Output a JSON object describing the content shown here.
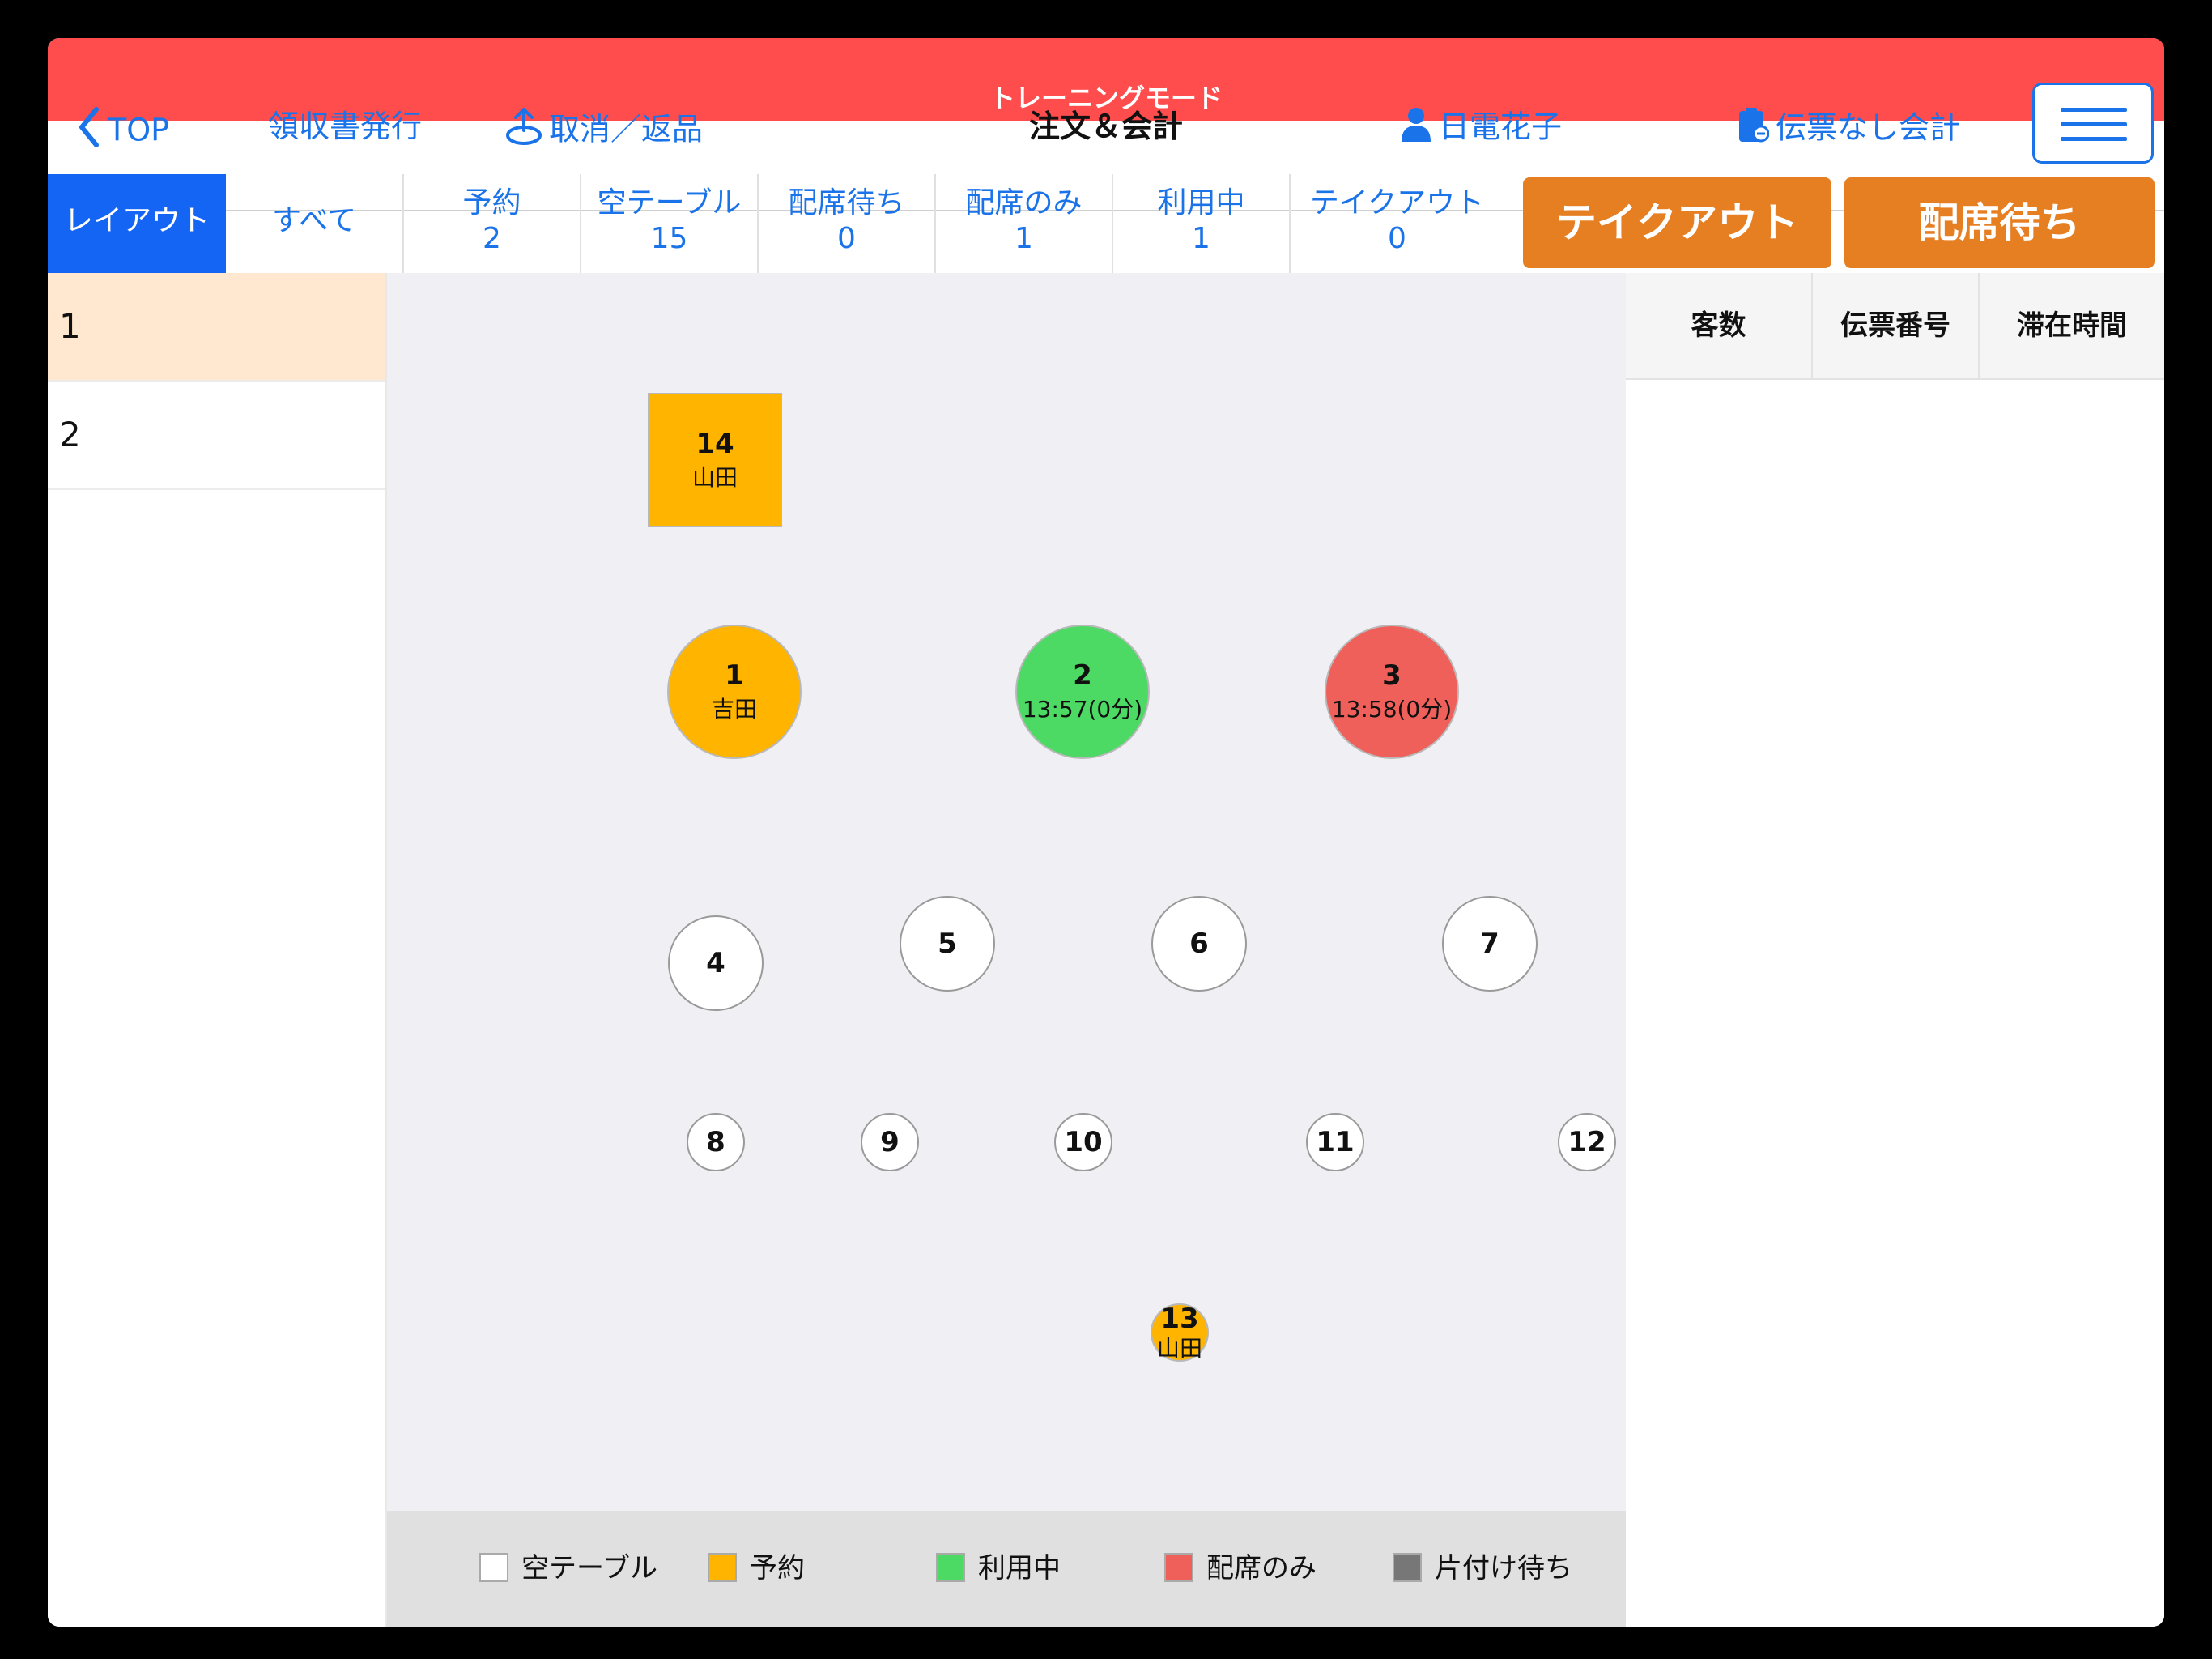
{
  "header": {
    "training_label": "トレーニングモード",
    "back_label": "TOP",
    "receipt_label": "領収書発行",
    "cancel_return_label": "取消／返品",
    "title": "注文＆会計",
    "user_name": "日電花子",
    "no_slip_label": "伝票なし会計",
    "colors": {
      "training_bar": "#ff4c4c",
      "link": "#1a73e8"
    }
  },
  "tabs": [
    {
      "label": "レイアウト",
      "count": null,
      "active": true
    },
    {
      "label": "すべて",
      "count": null
    },
    {
      "label": "予約",
      "count": "2"
    },
    {
      "label": "空テーブル",
      "count": "15"
    },
    {
      "label": "配席待ち",
      "count": "0"
    },
    {
      "label": "配席のみ",
      "count": "1"
    },
    {
      "label": "利用中",
      "count": "1"
    },
    {
      "label": "テイクアウト",
      "count": "0"
    }
  ],
  "actions": {
    "takeout": "テイクアウト",
    "waiting": "配席待ち",
    "color": "#e67e22"
  },
  "areas": [
    {
      "label": "1",
      "selected": true
    },
    {
      "label": "2",
      "selected": false
    }
  ],
  "tables": [
    {
      "id": "14",
      "sub": "山田",
      "status": "reserved",
      "shape": "square"
    },
    {
      "id": "1",
      "sub": "吉田",
      "status": "reserved",
      "shape": "circle"
    },
    {
      "id": "2",
      "sub": "13:57(0分)",
      "status": "inuse",
      "shape": "circle"
    },
    {
      "id": "3",
      "sub": "13:58(0分)",
      "status": "seated",
      "shape": "circle"
    },
    {
      "id": "4",
      "sub": "",
      "status": "empty",
      "shape": "circle"
    },
    {
      "id": "5",
      "sub": "",
      "status": "empty",
      "shape": "circle"
    },
    {
      "id": "6",
      "sub": "",
      "status": "empty",
      "shape": "circle"
    },
    {
      "id": "7",
      "sub": "",
      "status": "empty",
      "shape": "circle"
    },
    {
      "id": "8",
      "sub": "",
      "status": "empty",
      "shape": "circle"
    },
    {
      "id": "9",
      "sub": "",
      "status": "empty",
      "shape": "circle"
    },
    {
      "id": "10",
      "sub": "",
      "status": "empty",
      "shape": "circle"
    },
    {
      "id": "11",
      "sub": "",
      "status": "empty",
      "shape": "circle"
    },
    {
      "id": "12",
      "sub": "",
      "status": "empty",
      "shape": "circle"
    },
    {
      "id": "13",
      "sub": "山田",
      "status": "reserved",
      "shape": "circle"
    }
  ],
  "legend": [
    {
      "label": "空テーブル",
      "color": "#ffffff"
    },
    {
      "label": "予約",
      "color": "#ffb400"
    },
    {
      "label": "利用中",
      "color": "#4cd964"
    },
    {
      "label": "配席のみ",
      "color": "#f0605a"
    },
    {
      "label": "片付け待ち",
      "color": "#777777"
    }
  ],
  "right_panel": {
    "columns": [
      "客数",
      "伝票番号",
      "滞在時間"
    ]
  }
}
